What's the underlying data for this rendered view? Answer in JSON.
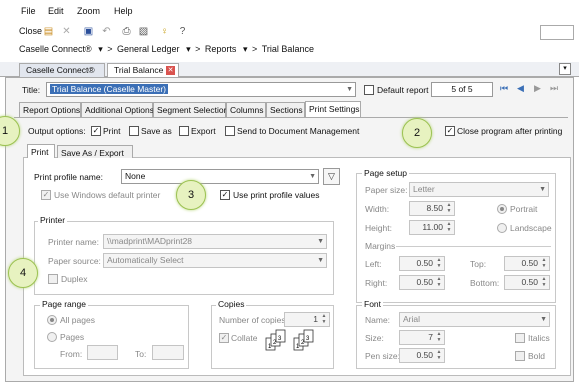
{
  "menu": {
    "file": "File",
    "edit": "Edit",
    "zoom": "Zoom",
    "help": "Help"
  },
  "toolbar": {
    "close_label": "Close"
  },
  "breadcrumb": {
    "item1": "Caselle Connect®",
    "item2": "General Ledger",
    "item3": "Reports",
    "item4": "Trial Balance",
    "arrow": "▾",
    "sep": ">"
  },
  "doc_tabs": {
    "tab1": "Caselle Connect®",
    "tab2": "Trial Balance"
  },
  "title_row": {
    "label": "Title:",
    "value": "Trial Balance (Caselle Master)",
    "default_report": "Default report",
    "pager": "5 of 5"
  },
  "report_tabs": [
    "Report Options",
    "Additional Options",
    "Segment Selection",
    "Columns",
    "Sections",
    "Print Settings"
  ],
  "output": {
    "label": "Output options:",
    "print": "Print",
    "save_as": "Save as",
    "export": "Export",
    "send": "Send to Document Management",
    "close_program": "Close program after printing"
  },
  "sub_tabs": [
    "Print",
    "Save As / Export"
  ],
  "print_profile": {
    "label": "Print profile name:",
    "value": "None",
    "use_windows_default": "Use Windows default printer",
    "use_print_profile_values": "Use print profile values"
  },
  "printer": {
    "title": "Printer",
    "name_label": "Printer name:",
    "name_value": "\\\\madprint\\MADprint28",
    "source_label": "Paper source:",
    "source_value": "Automatically Select",
    "duplex": "Duplex"
  },
  "page_setup": {
    "title": "Page setup",
    "paper_size_label": "Paper size:",
    "paper_size_value": "Letter",
    "width_label": "Width:",
    "width_value": "8.50",
    "height_label": "Height:",
    "height_value": "11.00",
    "portrait": "Portrait",
    "landscape": "Landscape",
    "margins": "Margins",
    "left_label": "Left:",
    "left_value": "0.50",
    "top_label": "Top:",
    "top_value": "0.50",
    "right_label": "Right:",
    "right_value": "0.50",
    "bottom_label": "Bottom:",
    "bottom_value": "0.50"
  },
  "page_range": {
    "title": "Page range",
    "all_pages": "All pages",
    "pages": "Pages",
    "from": "From:",
    "to": "To:"
  },
  "copies": {
    "title": "Copies",
    "number_label": "Number of copies:",
    "number_value": "1",
    "collate": "Collate"
  },
  "font": {
    "title": "Font",
    "name_label": "Name:",
    "name_value": "Arial",
    "size_label": "Size:",
    "size_value": "7",
    "pen_label": "Pen size:",
    "pen_value": "0.50",
    "italics": "Italics",
    "bold": "Bold"
  },
  "callouts": [
    "1",
    "2",
    "3",
    "4"
  ],
  "colors": {
    "accent": "#3b6fb6",
    "callout_fill": "#e7f2c0",
    "callout_border": "#9cc252",
    "panel": "#f4f4f4"
  }
}
